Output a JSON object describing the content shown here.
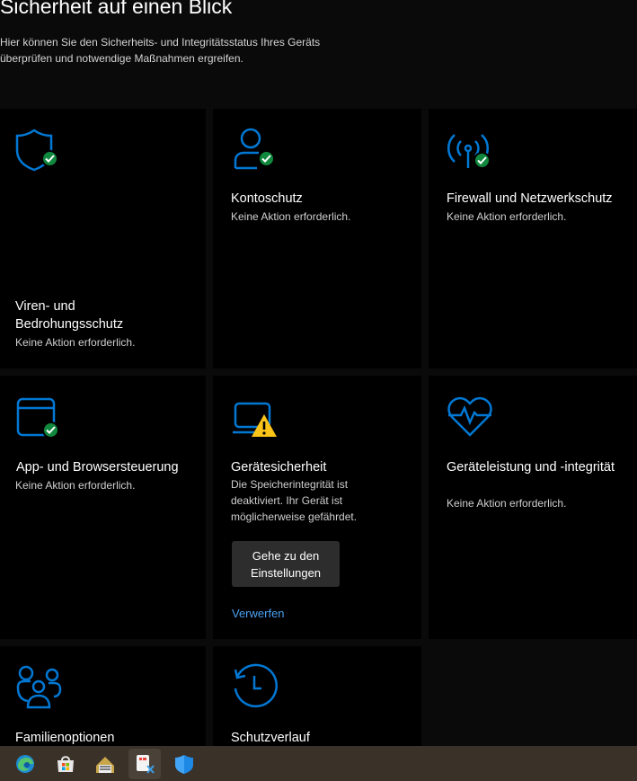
{
  "header": {
    "title": "Sicherheit auf einen Blick",
    "description": "Hier können Sie den Sicherheits- und Integritätsstatus Ihres Geräts überprüfen und notwendige Maßnahmen ergreifen."
  },
  "tiles": [
    {
      "id": "virus",
      "icon": "shield-icon",
      "badge": "ok",
      "title": "Viren- und Bedrohungsschutz",
      "status": "Keine Aktion erforderlich."
    },
    {
      "id": "account",
      "icon": "person-icon",
      "badge": "ok",
      "title": "Kontoschutz",
      "status": "Keine Aktion erforderlich."
    },
    {
      "id": "firewall",
      "icon": "antenna-icon",
      "badge": "ok",
      "title": "Firewall und Netzwerkschutz",
      "status": "Keine Aktion erforderlich."
    },
    {
      "id": "app-browser",
      "icon": "browser-window-icon",
      "badge": "ok",
      "title": "App- und Browsersteuerung",
      "status": "Keine Aktion erforderlich."
    },
    {
      "id": "device-security",
      "icon": "laptop-icon",
      "badge": "warning",
      "title": "Gerätesicherheit",
      "status": "Die Speicherintegrität ist deaktiviert. Ihr Gerät ist möglicherweise gefährdet.",
      "action_button": "Gehe zu den Einstellungen",
      "dismiss_link": "Verwerfen"
    },
    {
      "id": "performance",
      "icon": "heartbeat-icon",
      "badge": "none",
      "title": "Geräteleistung und -integrität",
      "status": "Keine Aktion erforderlich."
    },
    {
      "id": "family",
      "icon": "family-icon",
      "badge": "none",
      "title": "Familienoptionen",
      "status": ""
    },
    {
      "id": "history",
      "icon": "history-clock-icon",
      "badge": "none",
      "title": "Schutzverlauf",
      "status": ""
    }
  ],
  "colors": {
    "accent": "#0078d4",
    "ok": "#10893e",
    "warning": "#fcc419",
    "link": "#4aa0f0",
    "taskbar": "#3a3128"
  },
  "taskbar": {
    "items": [
      {
        "icon": "edge-browser-icon"
      },
      {
        "icon": "microsoft-store-icon"
      },
      {
        "icon": "app-icon"
      },
      {
        "icon": "snipping-tool-icon",
        "active": true
      },
      {
        "icon": "windows-security-icon"
      }
    ]
  }
}
